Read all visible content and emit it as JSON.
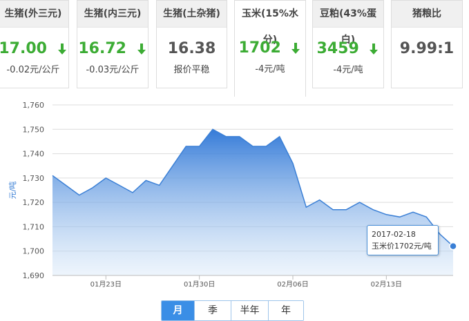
{
  "tabs": [
    {
      "title": "生猪(外三元)",
      "price": "17.00",
      "trend": "down",
      "change": "-0.02元/公斤"
    },
    {
      "title": "生猪(内三元)",
      "price": "16.72",
      "trend": "down",
      "change": "-0.03元/公斤"
    },
    {
      "title": "生猪(土杂猪)",
      "price": "16.38",
      "trend": "flat",
      "change": "报价平稳"
    },
    {
      "title": "玉米(15%水分)",
      "price": "1702",
      "trend": "down",
      "change": "-4元/吨",
      "active": true
    },
    {
      "title": "豆粕(43%蛋白)",
      "price": "3459",
      "trend": "down",
      "change": "-4元/吨"
    },
    {
      "title": "猪粮比",
      "price": "9.99:1",
      "trend": "flat",
      "change": ""
    }
  ],
  "colors": {
    "down": "#3cac34",
    "line": "#3a7fd5",
    "point": "#3a7fd5",
    "active_button": "#3a8ee6"
  },
  "chart_data": {
    "type": "area",
    "ylabel": "元/吨",
    "ylim": [
      1690,
      1760
    ],
    "yticks": [
      "1,690",
      "1,700",
      "1,710",
      "1,720",
      "1,730",
      "1,740",
      "1,750",
      "1,760"
    ],
    "xtick_labels": [
      "01月23日",
      "01月30日",
      "02月06日",
      "02月13日"
    ],
    "x": [
      "2017-01-19",
      "2017-01-20",
      "2017-01-21",
      "2017-01-22",
      "2017-01-23",
      "2017-01-24",
      "2017-01-25",
      "2017-01-26",
      "2017-01-27",
      "2017-01-28",
      "2017-01-29",
      "2017-01-30",
      "2017-01-31",
      "2017-02-01",
      "2017-02-02",
      "2017-02-03",
      "2017-02-04",
      "2017-02-05",
      "2017-02-06",
      "2017-02-07",
      "2017-02-08",
      "2017-02-09",
      "2017-02-10",
      "2017-02-11",
      "2017-02-12",
      "2017-02-13",
      "2017-02-14",
      "2017-02-15",
      "2017-02-16",
      "2017-02-17",
      "2017-02-18"
    ],
    "values": [
      1731,
      1727,
      1723,
      1726,
      1730,
      1727,
      1724,
      1729,
      1727,
      1735,
      1743,
      1743,
      1750,
      1747,
      1747,
      1743,
      1743,
      1747,
      1736,
      1718,
      1721,
      1717,
      1717,
      1720,
      1717,
      1715,
      1714,
      1716,
      1714,
      1707,
      1702
    ],
    "grid": true,
    "tooltip": {
      "date": "2017-02-18",
      "text": "玉米价1702元/吨"
    }
  },
  "ranges": [
    "月",
    "季",
    "半年",
    "年"
  ],
  "active_range": "月"
}
